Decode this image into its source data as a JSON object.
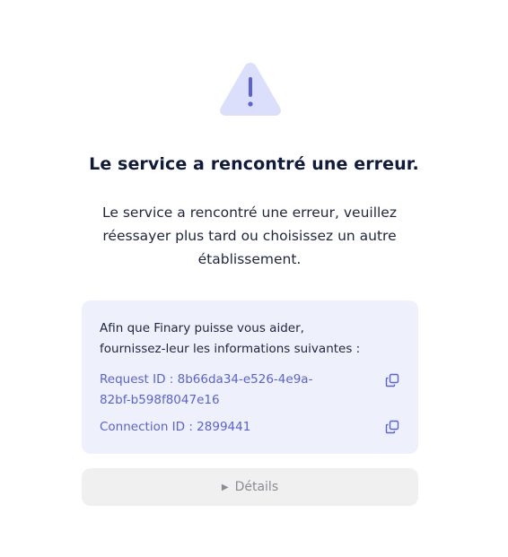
{
  "error": {
    "title": "Le service a rencontré une erreur.",
    "message": "Le service a rencontré une erreur, veuillez réessayer plus tard ou choisissez un autre établissement."
  },
  "info": {
    "intro_line1": "Afin que Finary puisse vous aider,",
    "intro_line2": "fournissez-leur les informations suivantes :",
    "request_id_line1": "Request ID : 8b66da34-e526-4e9a-",
    "request_id_line2": "82bf-b598f8047e16",
    "connection_id": "Connection ID : 2899441"
  },
  "details": {
    "label": "Détails",
    "arrow_icon": "triangle-right-icon"
  },
  "icons": {
    "warning": "warning-triangle-icon",
    "copy": "copy-icon"
  },
  "colors": {
    "accent": "#5a62d6",
    "warning_bg": "#dcdffb",
    "warning_fg": "#5a62d6",
    "info_bg": "#eef0fb",
    "title": "#101a3d",
    "details_bg": "#f0f0f1"
  }
}
